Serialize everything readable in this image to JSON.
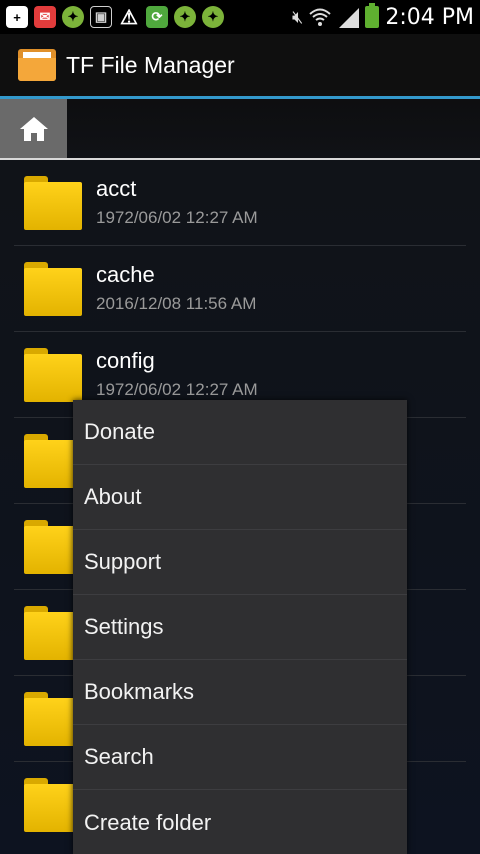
{
  "status_bar": {
    "time": "2:04 PM",
    "icons": [
      {
        "name": "add-notification-icon",
        "glyph": "+",
        "bg": "#ffffff"
      },
      {
        "name": "mail-icon",
        "glyph": "✉",
        "bg": "#e23c3c"
      },
      {
        "name": "app-notification-icon",
        "glyph": "✦",
        "bg": "#7cb33a"
      },
      {
        "name": "nfc-icon",
        "glyph": "▣",
        "bg": "#cfcfcf"
      },
      {
        "name": "warning-icon",
        "glyph": "⚠",
        "bg": "#ffffff"
      },
      {
        "name": "sync-icon",
        "glyph": "⟳",
        "bg": "#4fa83d"
      },
      {
        "name": "app-notification-icon-2",
        "glyph": "✦",
        "bg": "#7cb33a"
      },
      {
        "name": "app-notification-icon-3",
        "glyph": "✦",
        "bg": "#7cb33a"
      }
    ]
  },
  "app": {
    "title": "TF File Manager",
    "accent_color": "#3399cc"
  },
  "files": [
    {
      "name": "acct",
      "date": "1972/06/02 12:27 AM"
    },
    {
      "name": "cache",
      "date": "2016/12/08 11:56 AM"
    },
    {
      "name": "config",
      "date": "1972/06/02 12:27 AM"
    }
  ],
  "menu": {
    "items": [
      {
        "label": "Donate"
      },
      {
        "label": "About"
      },
      {
        "label": "Support"
      },
      {
        "label": "Settings"
      },
      {
        "label": "Bookmarks"
      },
      {
        "label": "Search"
      },
      {
        "label": "Create folder"
      }
    ]
  }
}
